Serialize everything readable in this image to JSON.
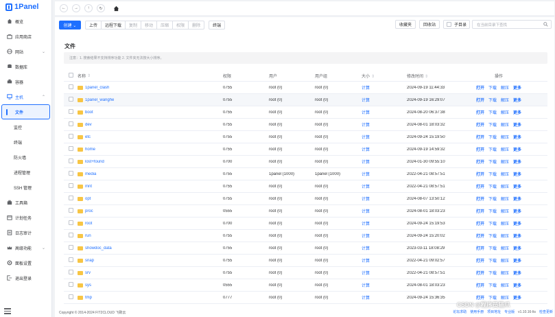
{
  "app": {
    "logo": "1Panel"
  },
  "sidebar": {
    "items": [
      {
        "label": "概览",
        "icon": "home-icon"
      },
      {
        "label": "应用商店",
        "icon": "store-icon"
      },
      {
        "label": "网站",
        "icon": "globe-icon",
        "arrow": "⌄"
      },
      {
        "label": "数据库",
        "icon": "database-icon"
      },
      {
        "label": "容器",
        "icon": "container-icon"
      },
      {
        "label": "主机",
        "icon": "host-icon",
        "arrow": "⌃"
      }
    ],
    "host_sub": [
      {
        "label": "文件",
        "active": true
      },
      {
        "label": "监控"
      },
      {
        "label": "终端"
      },
      {
        "label": "防火墙"
      },
      {
        "label": "进程管理"
      },
      {
        "label": "SSH 管理"
      }
    ],
    "items_after": [
      {
        "label": "工具箱",
        "icon": "toolbox-icon"
      },
      {
        "label": "计划任务",
        "icon": "calendar-icon"
      },
      {
        "label": "日志审计",
        "icon": "log-icon"
      },
      {
        "label": "高级功能",
        "icon": "crown-icon",
        "arrow": "⌄"
      },
      {
        "label": "面板设置",
        "icon": "settings-icon"
      },
      {
        "label": "退出登录",
        "icon": "logout-icon"
      }
    ]
  },
  "toolbar": {
    "create": "创建 ⌄",
    "upload": "上传",
    "remote_download": "远程下载",
    "copy": "复制",
    "move": "移动",
    "compress": "压缩",
    "permission": "权限",
    "delete": "删除",
    "terminal": "终端",
    "favorites": "收藏夹",
    "recycle_bin": "回收站",
    "subdir": "子目录",
    "search_placeholder": "在当前目录下查找"
  },
  "page": {
    "title": "文件",
    "notice": "注意：1. 搜索结果不支持排序功能 2. 文件夹无法按大小排序。"
  },
  "table": {
    "headers": {
      "name": "名称",
      "perm": "权限",
      "user": "用户",
      "group": "用户组",
      "size": "大小",
      "mtime": "修改时间",
      "ops": "操作"
    },
    "op_labels": {
      "open": "打开",
      "download": "下载",
      "decompress": "解压",
      "more": "更多"
    },
    "calc_label": "计算",
    "rows": [
      {
        "name": "1panel_clash",
        "perm": "0755",
        "user": "root (0)",
        "group": "root (0)",
        "mtime": "2024-09-19 11:44:33"
      },
      {
        "name": "1panel_wanghe",
        "perm": "0755",
        "user": "root (0)",
        "group": "root (0)",
        "mtime": "2024-09-19 16:29:07"
      },
      {
        "name": "boot",
        "perm": "0755",
        "user": "root (0)",
        "group": "root (0)",
        "mtime": "2024-08-20 06:37:38"
      },
      {
        "name": "dev",
        "perm": "0755",
        "user": "root (0)",
        "group": "root (0)",
        "mtime": "2024-08-01 18:03:32"
      },
      {
        "name": "etc",
        "perm": "0755",
        "user": "root (0)",
        "group": "root (0)",
        "mtime": "2024-09-24 15:19:50"
      },
      {
        "name": "home",
        "perm": "0755",
        "user": "root (0)",
        "group": "root (0)",
        "mtime": "2024-09-19 14:59:32"
      },
      {
        "name": "lost+found",
        "perm": "0700",
        "user": "root (0)",
        "group": "root (0)",
        "mtime": "2024-01-30 09:55:10"
      },
      {
        "name": "media",
        "perm": "0755",
        "user": "1panel (1000)",
        "group": "1panel (1000)",
        "mtime": "2022-04-21 08:57:51"
      },
      {
        "name": "mnt",
        "perm": "0755",
        "user": "root (0)",
        "group": "root (0)",
        "mtime": "2022-04-21 08:57:51"
      },
      {
        "name": "opt",
        "perm": "0755",
        "user": "root (0)",
        "group": "root (0)",
        "mtime": "2024-08-07 13:50:12"
      },
      {
        "name": "proc",
        "perm": "0555",
        "user": "root (0)",
        "group": "root (0)",
        "mtime": "2024-08-01 18:03:23"
      },
      {
        "name": "root",
        "perm": "0700",
        "user": "root (0)",
        "group": "root (0)",
        "mtime": "2024-09-24 15:19:53"
      },
      {
        "name": "run",
        "perm": "0755",
        "user": "root (0)",
        "group": "root (0)",
        "mtime": "2024-09-24 15:20:02"
      },
      {
        "name": "showdoc_data",
        "perm": "0755",
        "user": "root (0)",
        "group": "root (0)",
        "mtime": "2023-03-11 18:08:29"
      },
      {
        "name": "snap",
        "perm": "0755",
        "user": "root (0)",
        "group": "root (0)",
        "mtime": "2022-04-21 09:02:57"
      },
      {
        "name": "srv",
        "perm": "0755",
        "user": "root (0)",
        "group": "root (0)",
        "mtime": "2022-04-21 08:57:51"
      },
      {
        "name": "sys",
        "perm": "0555",
        "user": "root (0)",
        "group": "root (0)",
        "mtime": "2024-08-01 18:03:23"
      },
      {
        "name": "tmp",
        "perm": "0777",
        "user": "root (0)",
        "group": "root (0)",
        "mtime": "2024-09-24 15:36:35"
      }
    ]
  },
  "footer": {
    "copyright": "Copyright © 2014-2024 FIT2CLOUD 飞致云",
    "forum": "论坛求助",
    "docs": "使用手册",
    "project": "项目地址",
    "edition": "专业版",
    "version": "v1.10.16-lts",
    "update": "检查更新"
  },
  "watermark": "CSDN @程序员猫爪",
  "colors": {
    "accent": "#1e6fff",
    "folder": "#f7c544"
  }
}
